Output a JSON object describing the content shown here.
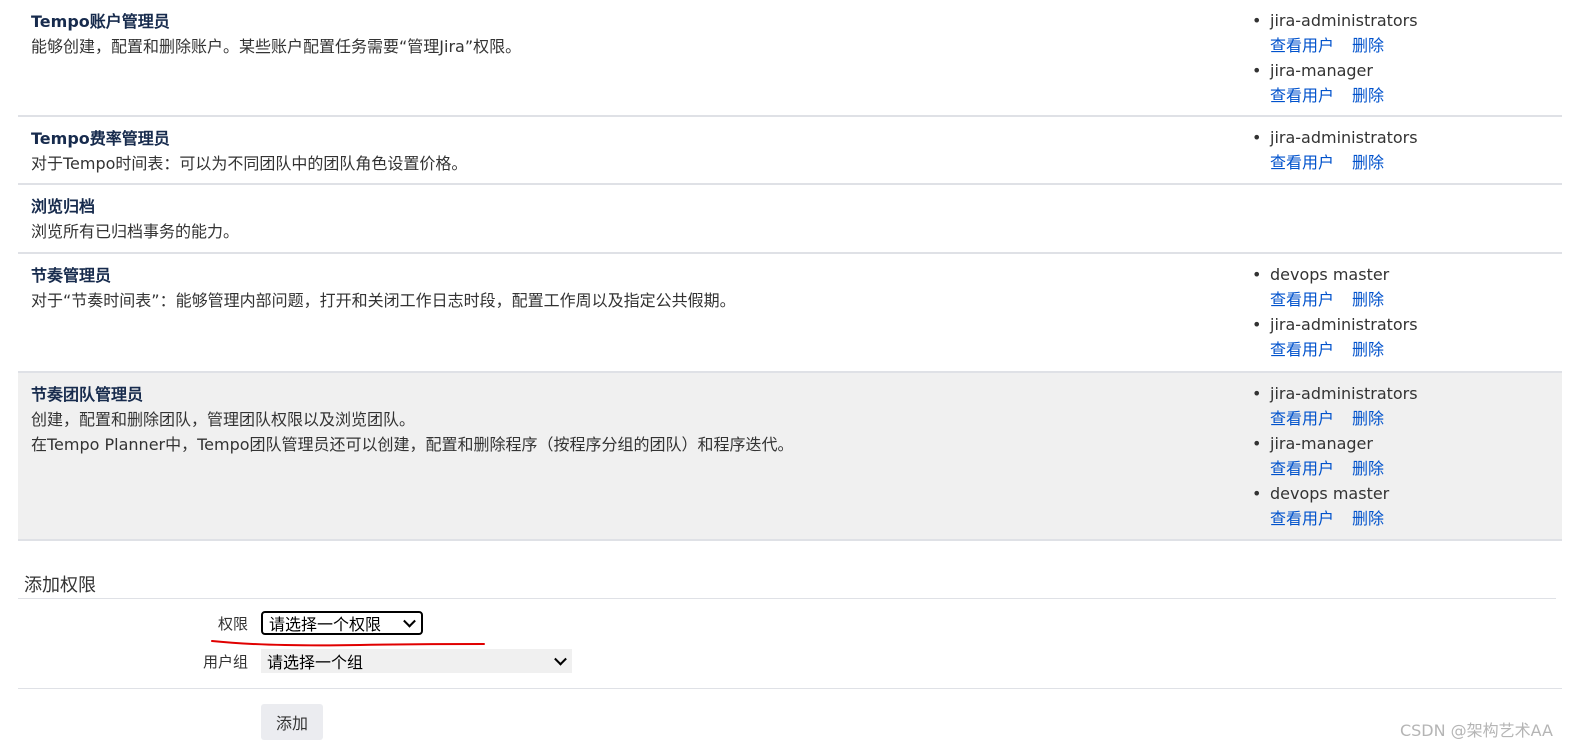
{
  "permissions": [
    {
      "title": "Tempo账户管理员",
      "desc": [
        "能够创建，配置和删除账户。某些账户配置任务需要“管理Jira”权限。"
      ],
      "groups": [
        "jira-administrators",
        "jira-manager"
      ]
    },
    {
      "title": "Tempo费率管理员",
      "desc": [
        "对于Tempo时间表：可以为不同团队中的团队角色设置价格。"
      ],
      "groups": [
        "jira-administrators"
      ]
    },
    {
      "title": "浏览归档",
      "desc": [
        "浏览所有已归档事务的能力。"
      ],
      "groups": []
    },
    {
      "title": "节奏管理员",
      "desc": [
        "对于“节奏时间表”：能够管理内部问题，打开和关闭工作日志时段，配置工作周以及指定公共假期。"
      ],
      "groups": [
        "devops master",
        "jira-administrators"
      ]
    },
    {
      "title": "节奏团队管理员",
      "desc": [
        "创建，配置和删除团队，管理团队权限以及浏览团队。",
        "在Tempo Planner中，Tempo团队管理员还可以创建，配置和删除程序（按程序分组的团队）和程序迭代。"
      ],
      "groups": [
        "jira-administrators",
        "jira-manager",
        "devops master"
      ]
    }
  ],
  "actions": {
    "view_users": "查看用户",
    "delete": "删除"
  },
  "add_permission": {
    "title": "添加权限",
    "permission_label": "权限",
    "permission_value": "请选择一个权限",
    "group_label": "用户组",
    "group_value": "请选择一个组",
    "add_button": "添加"
  },
  "watermark": "CSDN @架构艺术AA",
  "colors": {
    "link": "#0052cc",
    "highlight_row": "#f0f0f0",
    "annotation_red": "#e00000"
  }
}
